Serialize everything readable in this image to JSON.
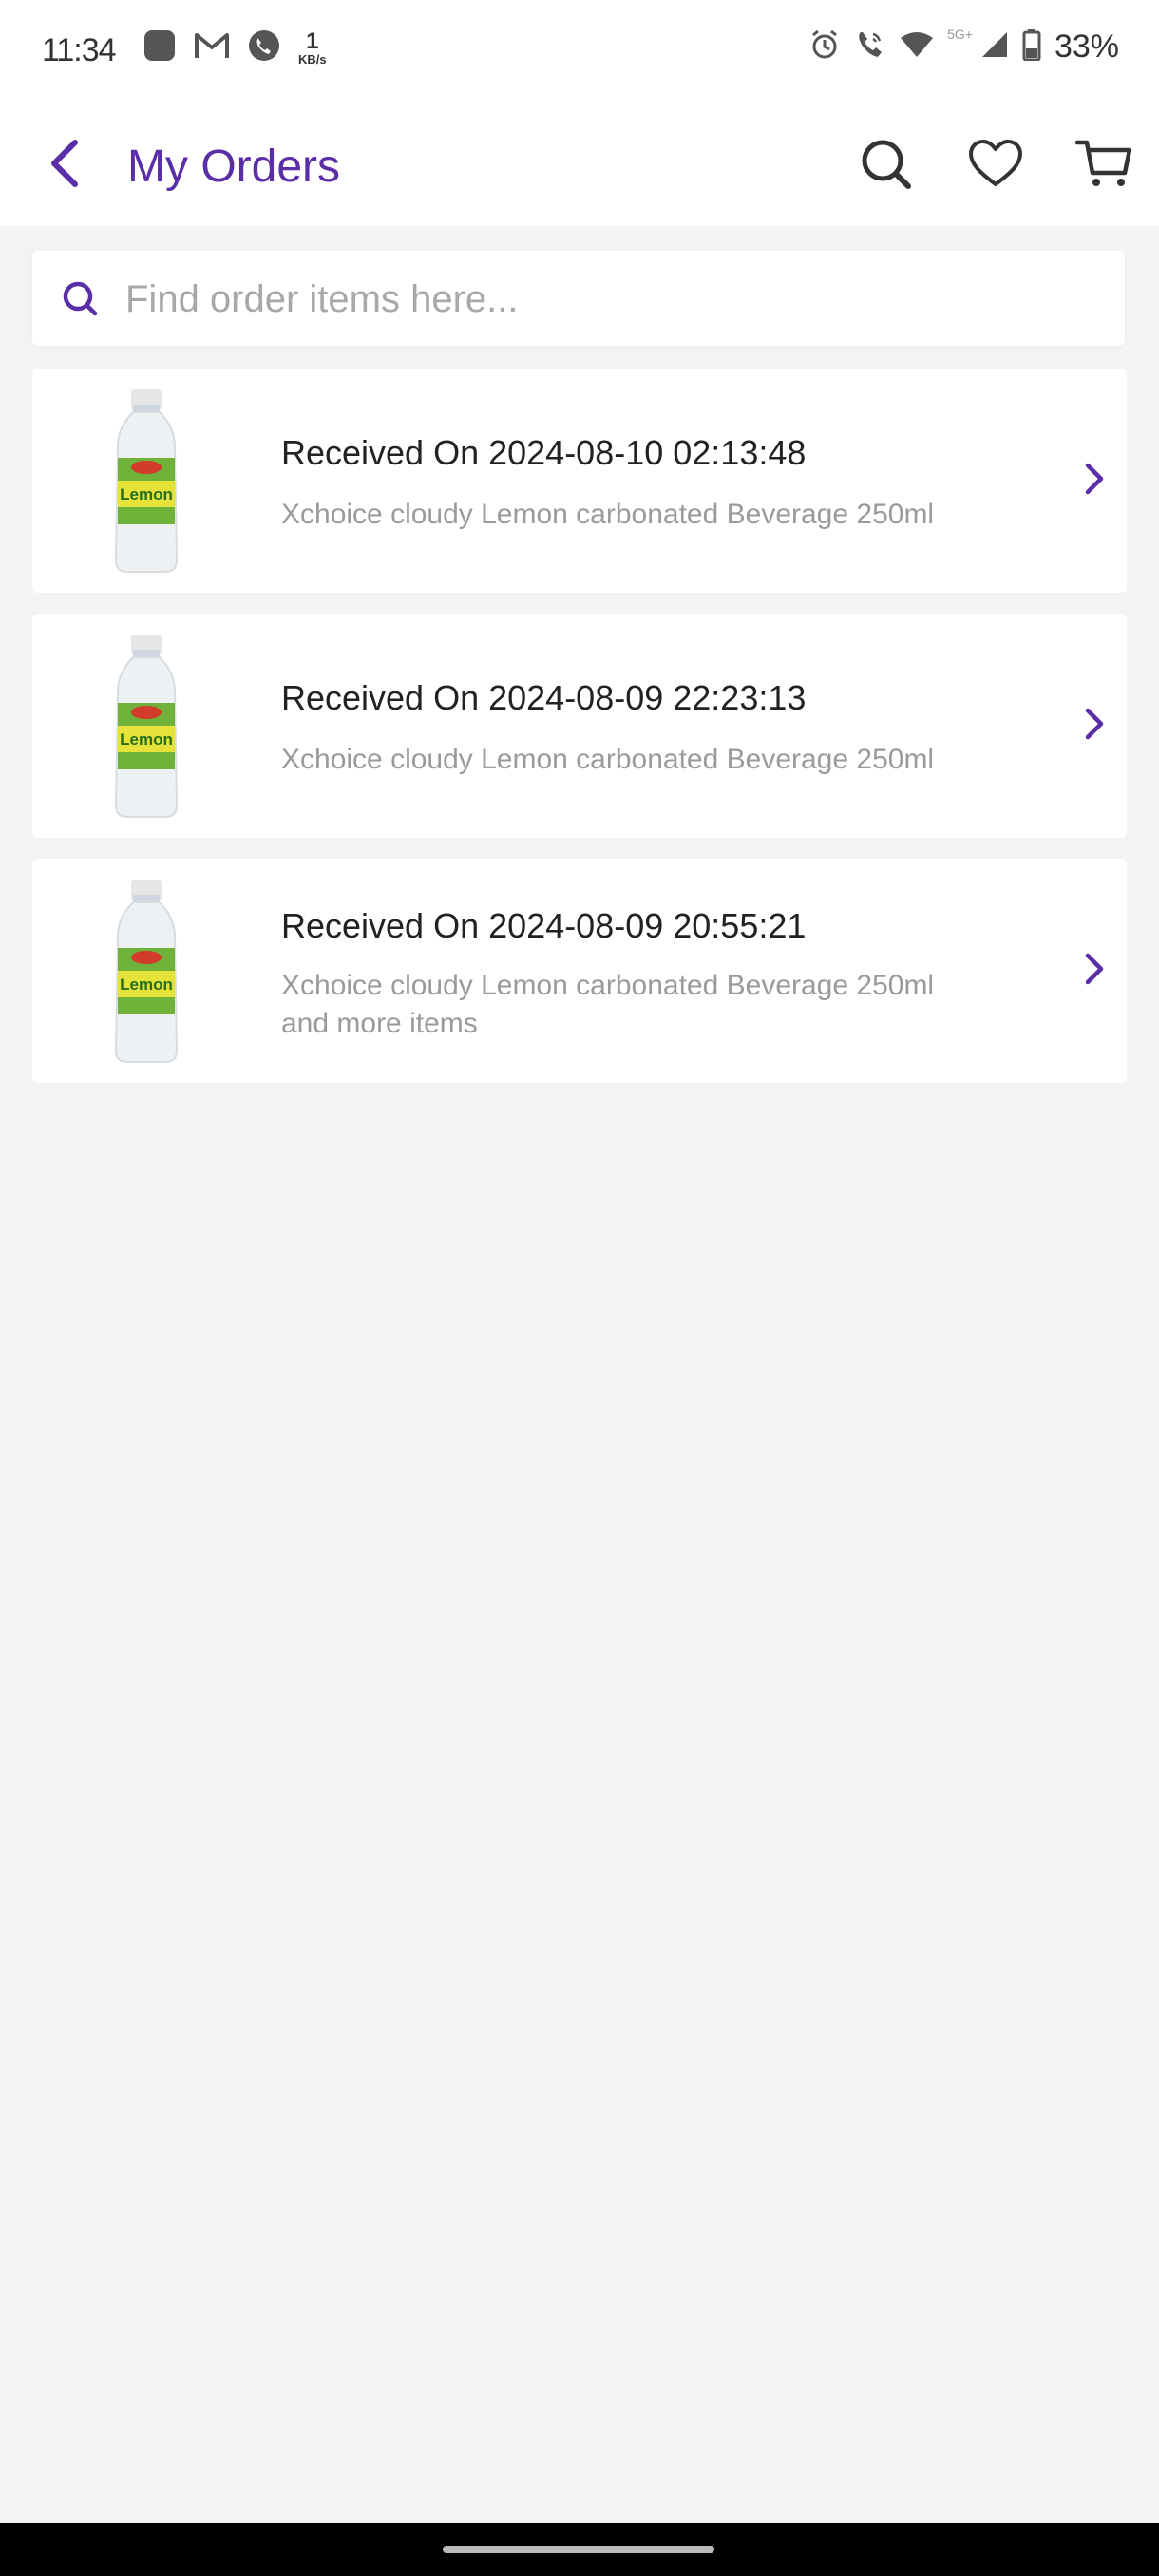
{
  "status_bar": {
    "time": "11:34",
    "net_speed_value": "1",
    "net_speed_unit": "KB/s",
    "network_label": "5G+",
    "battery": "33%",
    "icons_left": [
      "app-icon",
      "gmail-icon",
      "phone-app-icon"
    ],
    "icons_right": [
      "alarm-icon",
      "wifi-calling-icon",
      "wifi-icon",
      "signal-icon",
      "battery-icon"
    ]
  },
  "header": {
    "title": "My Orders",
    "icons": [
      "back-arrow-icon",
      "search-icon",
      "heart-icon",
      "cart-icon"
    ]
  },
  "search": {
    "placeholder": "Find order items here...",
    "value": ""
  },
  "orders": [
    {
      "title": "Received On 2024-08-10 02:13:48",
      "description": "Xchoice cloudy Lemon carbonated Beverage 250ml",
      "more": ""
    },
    {
      "title": "Received On 2024-08-09 22:23:13",
      "description": "Xchoice cloudy Lemon carbonated Beverage 250ml",
      "more": ""
    },
    {
      "title": "Received On 2024-08-09 20:55:21",
      "description": "Xchoice cloudy Lemon carbonated Beverage 250ml",
      "more": "and more items"
    }
  ],
  "product_image_label": "Lemon",
  "colors": {
    "accent": "#5a2ea6",
    "background": "#f3f3f3",
    "card": "#ffffff",
    "muted_text": "#9a9a9a"
  }
}
